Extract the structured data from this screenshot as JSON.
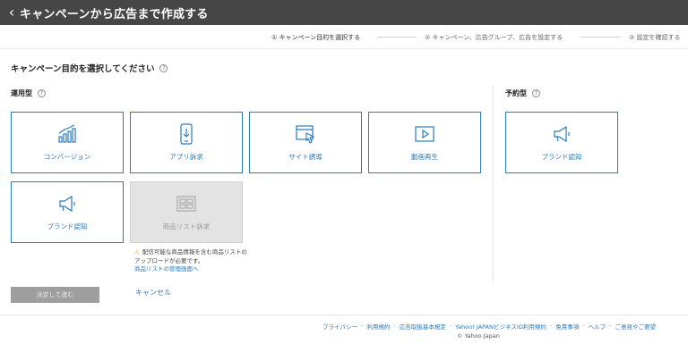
{
  "header": {
    "title": "キャンペーンから広告まで作成する"
  },
  "steps": [
    {
      "label": "① キャンペーン目的を選択する"
    },
    {
      "label": "② キャンペーン、広告グループ、広告を設定する"
    },
    {
      "label": "③ 設定を確認する"
    }
  ],
  "main": {
    "heading": "キャンペーン目的を選択してください",
    "sections": {
      "operational": "運用型",
      "reservation": "予約型"
    },
    "cards": {
      "conversion": "コンバージョン",
      "app_promo": "アプリ訴求",
      "site_traffic": "サイト誘導",
      "video_play": "動画再生",
      "brand_awareness": "ブランド認知",
      "product_list": "商品リスト訴求",
      "reserve_brand": "ブランド認知"
    },
    "note": {
      "text": "配信可能な商品情報を含む商品リストのアップロードが必要です。",
      "link": "商品リストの管理画面へ"
    },
    "actions": {
      "confirm": "決定して進む",
      "cancel": "キャンセル"
    }
  },
  "footer": {
    "links": [
      "プライバシー",
      "利用規約",
      "広告取扱基本規定",
      "Yahoo! JAPANビジネスID利用規約",
      "免責事項",
      "ヘルプ",
      "ご意見やご要望"
    ],
    "copyright": "© Yahoo Japan"
  },
  "colors": {
    "accent": "#2b7bbd",
    "header_bg": "#464646",
    "disabled_bg": "#e3e3e3",
    "warning": "#e7a800"
  }
}
